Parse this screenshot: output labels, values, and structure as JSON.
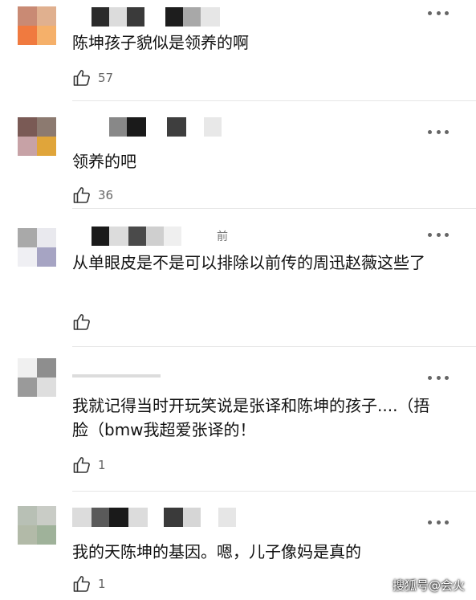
{
  "comments": [
    {
      "text": "陈坤孩子貌似是领养的啊",
      "likes": "57",
      "time": ""
    },
    {
      "text": "领养的吧",
      "likes": "36",
      "time": ""
    },
    {
      "text": "从单眼皮是不是可以排除以前传的周迅赵薇这些了",
      "likes": "",
      "time": "前"
    },
    {
      "text": "我就记得当时开玩笑说是张译和陈坤的孩子....（捂脸（bmw我超爱张译的！",
      "likes": "1",
      "time": ""
    },
    {
      "text": "我的天陈坤的基因。嗯，儿子像妈是真的",
      "likes": "1",
      "time": ""
    }
  ],
  "icons": {
    "like": "thumbs-up-icon",
    "more": "more-dots-icon"
  },
  "watermark": "搜狐号@会火",
  "colors": {
    "text": "#111111",
    "meta": "#666666",
    "divider": "#e6e6e6"
  }
}
